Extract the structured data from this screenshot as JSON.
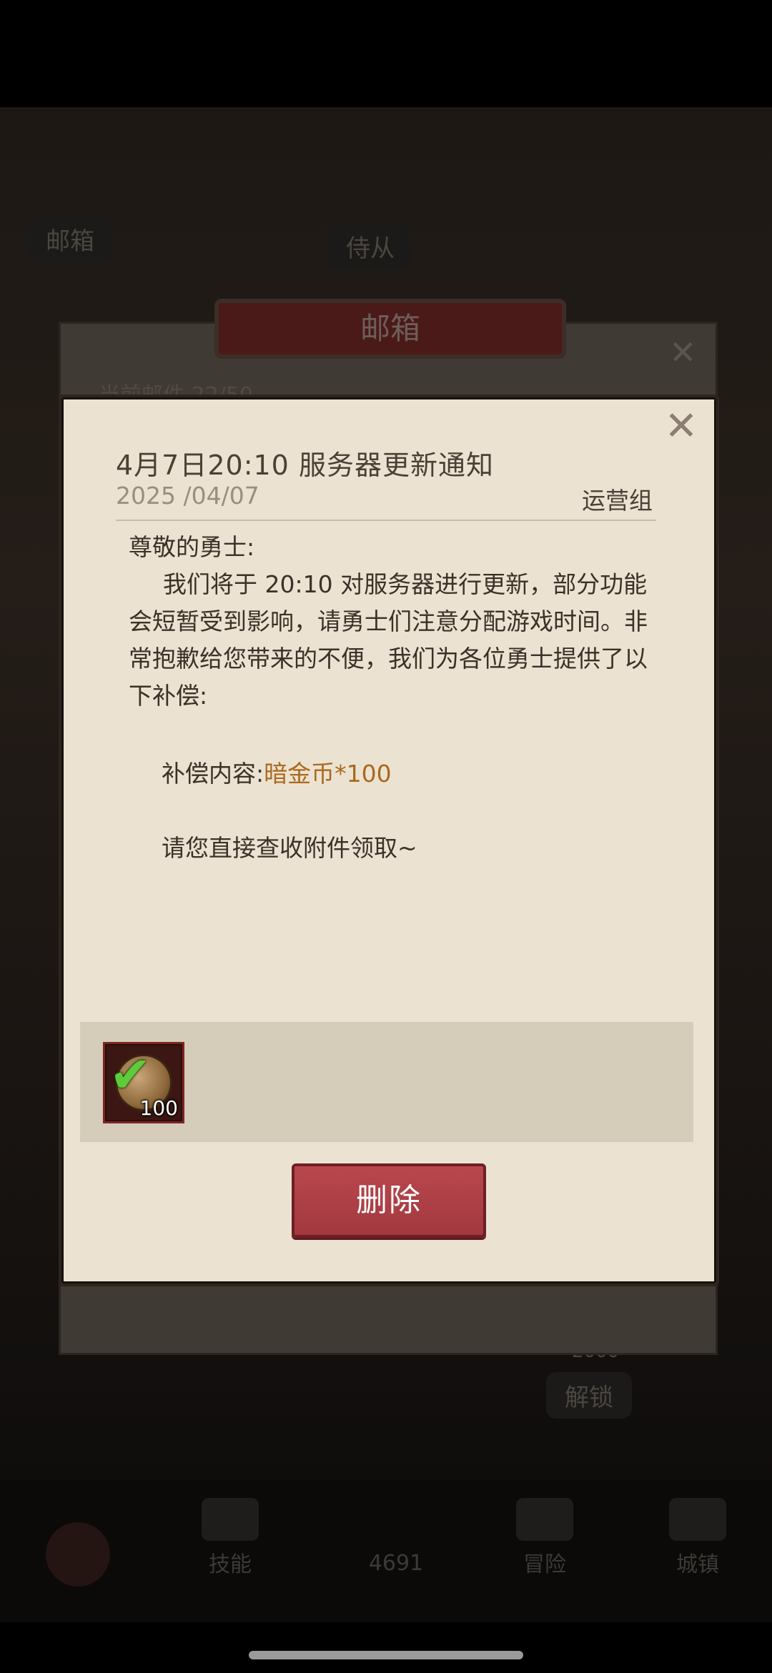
{
  "background": {
    "mailbox_chip": "邮箱",
    "follower_chip": "侍从",
    "unlock_chip": "解锁",
    "gold_amount": "2000",
    "nav": [
      {
        "label": "技能"
      },
      {
        "label": "4691"
      },
      {
        "label": "冒险"
      },
      {
        "label": "城镇"
      }
    ]
  },
  "outer_window": {
    "title": "邮箱",
    "subtitle": "当前邮件 22/50"
  },
  "mail": {
    "title": "4月7日20:10 服务器更新通知",
    "date": "2025 /04/07",
    "sender": "运营组",
    "greeting": "尊敬的勇士:",
    "paragraph": "我们将于 20:10 对服务器进行更新，部分功能会短暂受到影响，请勇士们注意分配游戏时间。非常抱歉给您带来的不便，我们为各位勇士提供了以下补偿:",
    "compensation_label": "补偿内容:",
    "compensation_value": "暗金币*100",
    "claim_text": "请您直接查收附件领取~",
    "attachment_qty": "100",
    "delete_label": "删除",
    "close_symbol": "✕"
  },
  "colors": {
    "accent_gold": "#a9691e",
    "delete_red": "#a9404a",
    "parchment": "#ece2d1",
    "check_green": "#5fcb3a"
  },
  "icons": [
    "close-icon",
    "coin-icon",
    "check-icon"
  ]
}
